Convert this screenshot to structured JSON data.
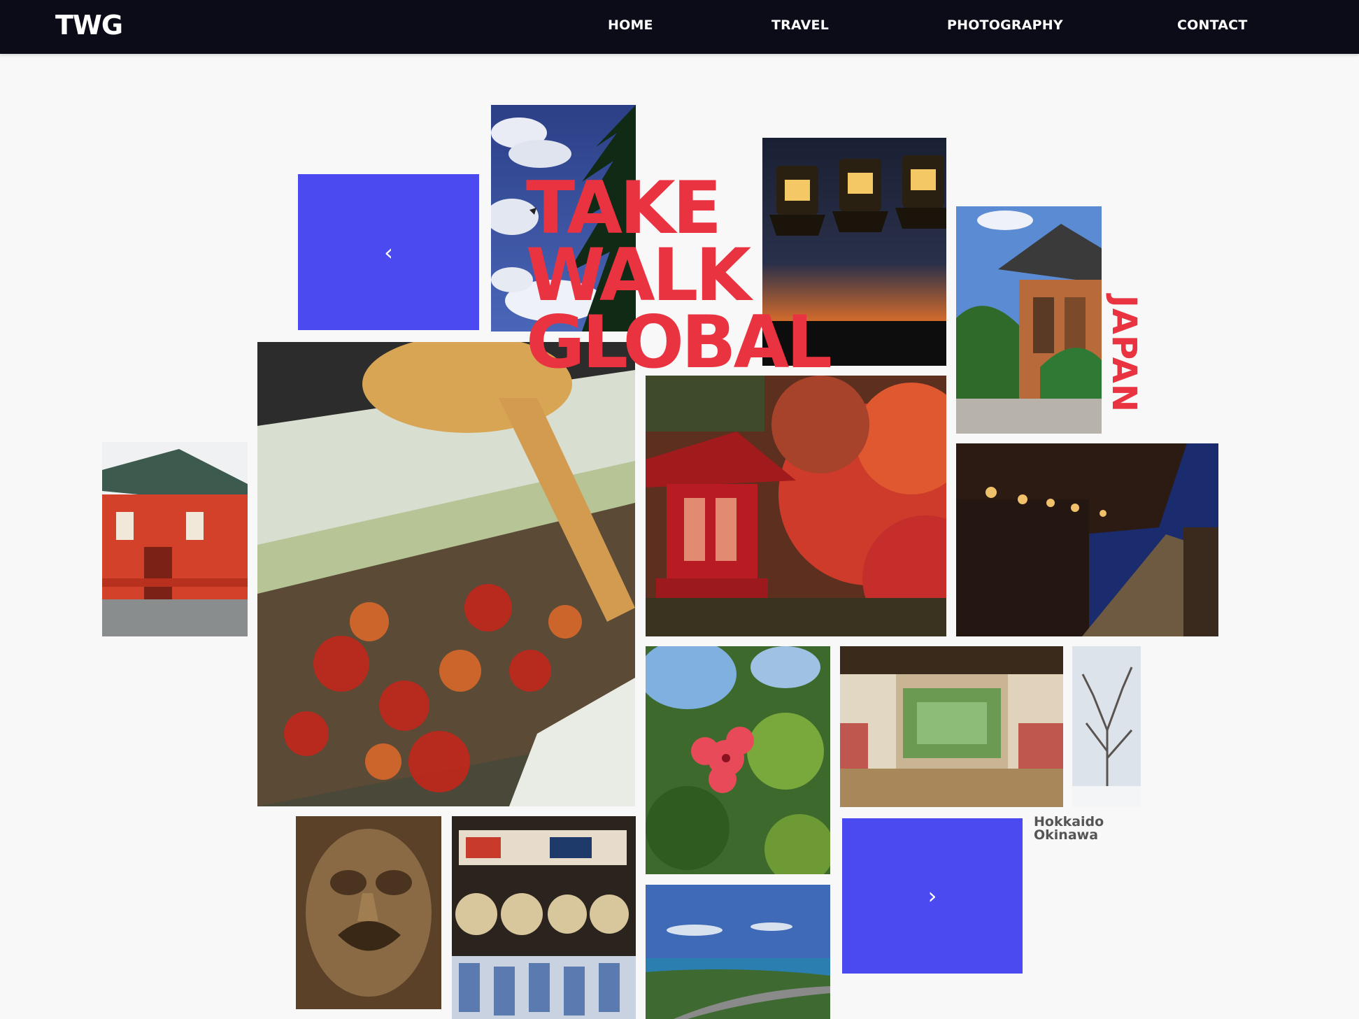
{
  "brand": {
    "logo": "TWG"
  },
  "nav": {
    "items": [
      {
        "label": "HOME"
      },
      {
        "label": "TRAVEL"
      },
      {
        "label": "PHOTOGRAPHY"
      },
      {
        "label": "CONTACT"
      }
    ]
  },
  "hero": {
    "lines": [
      "TAKE",
      "WALK",
      "GLOBAL"
    ],
    "country": "JAPAN"
  },
  "carousel": {
    "prev_icon": "chevron-left-icon",
    "next_icon": "chevron-right-icon",
    "prev_glyph": "‹",
    "next_glyph": "›"
  },
  "regions": [
    "Hokkaido",
    "Okinawa"
  ],
  "colors": {
    "nav_bg": "#0b0c17",
    "accent_blue": "#4a4af0",
    "headline_red": "#ea3340",
    "page_bg": "#f8f8f8"
  }
}
